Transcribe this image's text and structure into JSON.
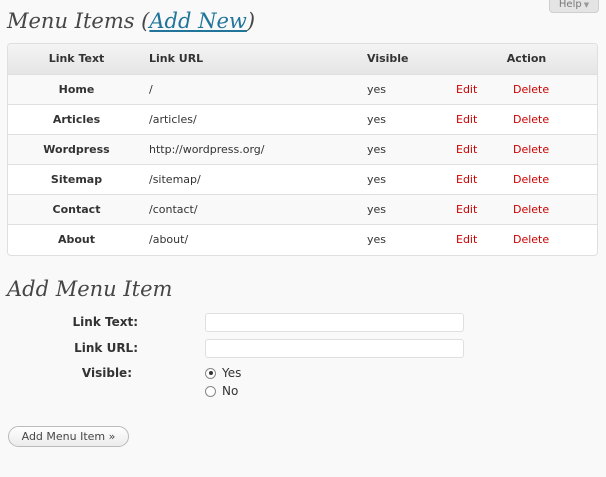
{
  "help_tab": {
    "label": "Help",
    "arrow": "▼"
  },
  "menu_section": {
    "title_prefix": "Menu Items (",
    "add_new": "Add New",
    "title_suffix": ")"
  },
  "table": {
    "headers": {
      "link_text": "Link Text",
      "link_url": "Link URL",
      "visible": "Visible",
      "action": "Action"
    },
    "rows": [
      {
        "text": "Home",
        "url": "/",
        "visible": "yes",
        "edit": "Edit",
        "delete": "Delete"
      },
      {
        "text": "Articles",
        "url": "/articles/",
        "visible": "yes",
        "edit": "Edit",
        "delete": "Delete"
      },
      {
        "text": "Wordpress",
        "url": "http://wordpress.org/",
        "visible": "yes",
        "edit": "Edit",
        "delete": "Delete"
      },
      {
        "text": "Sitemap",
        "url": "/sitemap/",
        "visible": "yes",
        "edit": "Edit",
        "delete": "Delete"
      },
      {
        "text": "Contact",
        "url": "/contact/",
        "visible": "yes",
        "edit": "Edit",
        "delete": "Delete"
      },
      {
        "text": "About",
        "url": "/about/",
        "visible": "yes",
        "edit": "Edit",
        "delete": "Delete"
      }
    ]
  },
  "add_section": {
    "title": "Add Menu Item",
    "link_text_label": "Link Text:",
    "link_text_value": "",
    "link_url_label": "Link URL:",
    "link_url_value": "",
    "visible_label": "Visible:",
    "options": {
      "yes": "Yes",
      "no": "No"
    },
    "selected": "Yes",
    "submit": "Add Menu Item »"
  },
  "colors": {
    "link": "#21759b",
    "action": "#cc0000",
    "header_bg": "#e9e9e9",
    "border": "#dfdfdf"
  },
  "icons": {
    "help_arrow": "chevron-down-icon"
  }
}
